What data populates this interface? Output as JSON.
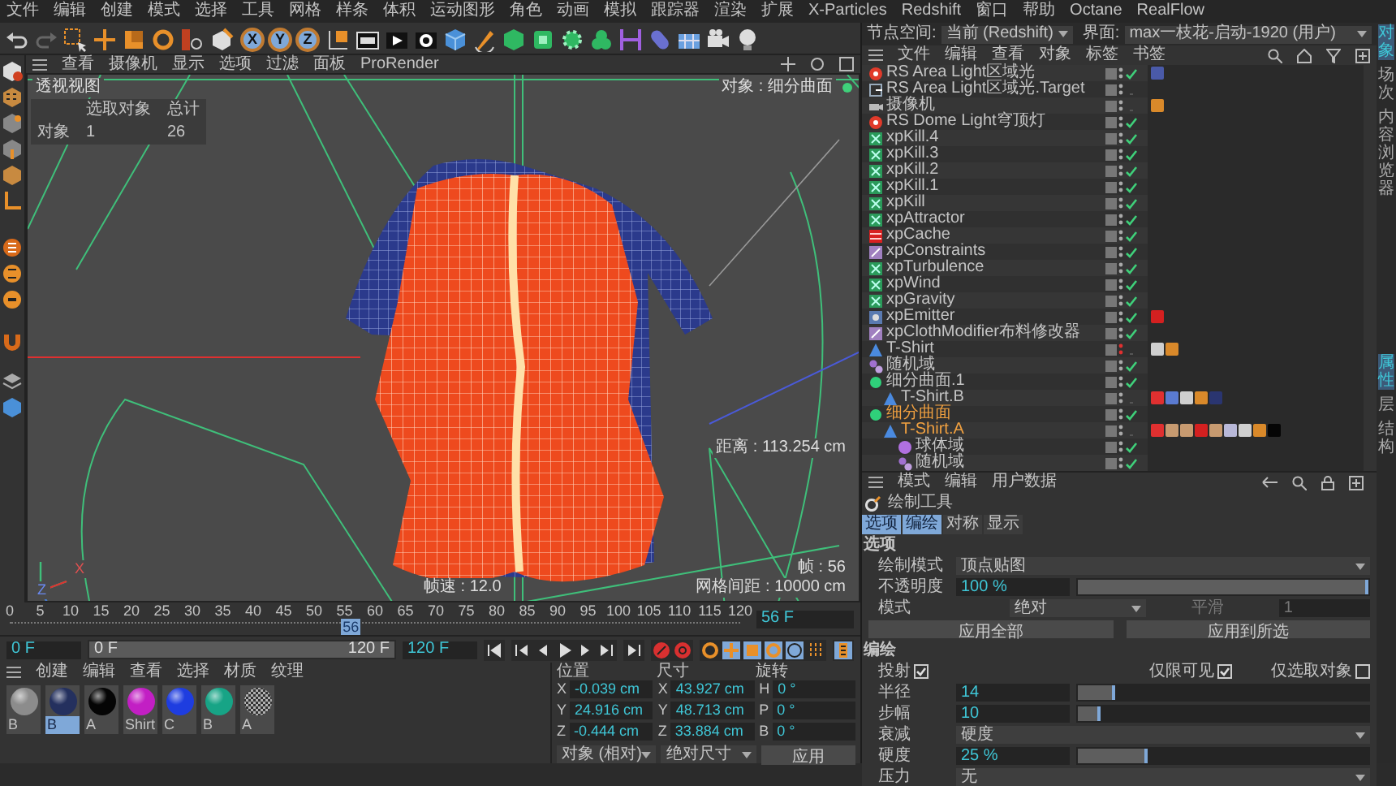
{
  "menu_bar": [
    "文件",
    "编辑",
    "创建",
    "模式",
    "选择",
    "工具",
    "网格",
    "样条",
    "体积",
    "运动图形",
    "角色",
    "动画",
    "模拟",
    "跟踪器",
    "渲染",
    "扩展",
    "X-Particles",
    "Redshift",
    "窗口",
    "帮助",
    "Octane",
    "RealFlow"
  ],
  "toolbar": {
    "axis_buttons": [
      {
        "label": "X",
        "on": true
      },
      {
        "label": "Y",
        "on": true
      },
      {
        "label": "Z",
        "on": true
      }
    ]
  },
  "viewport": {
    "menu": [
      "查看",
      "摄像机",
      "显示",
      "选项",
      "过滤",
      "面板",
      "ProRender"
    ],
    "view_name": "透视视图",
    "stats": {
      "header_1": "选取对象",
      "header_2": "总计",
      "row_label": "对象",
      "selected": "1",
      "total": "26"
    },
    "active_object": "对象 : 细分曲面",
    "distance": "距离 : 113.254 cm",
    "fps": "帧速 : 12.0",
    "frame": "帧 : 56",
    "grid_spacing": "网格间距 : 10000 cm",
    "axes": [
      "X",
      "Z"
    ]
  },
  "timeline": {
    "ticks": [
      "0",
      "5",
      "10",
      "15",
      "20",
      "25",
      "30",
      "35",
      "40",
      "45",
      "50",
      "55",
      "60",
      "65",
      "70",
      "75",
      "80",
      "85",
      "90",
      "95",
      "100",
      "105",
      "110",
      "115",
      "120"
    ],
    "current": "56",
    "level": 0.467,
    "current_field": "56 F",
    "start_field": "0 F",
    "range": {
      "start": "0 F",
      "end": "120 F",
      "level": 1
    },
    "end_field": "120 F"
  },
  "materials": {
    "menu": [
      "创建",
      "编辑",
      "查看",
      "选择",
      "材质",
      "纹理"
    ],
    "items": [
      {
        "name": "B",
        "kind": "sphere",
        "color": "#8c8c8c",
        "selected": false
      },
      {
        "name": "B",
        "kind": "sphere",
        "color": "#24305e",
        "selected": true
      },
      {
        "name": "A",
        "kind": "sphere",
        "color": "#050505",
        "selected": false
      },
      {
        "name": "Shirt",
        "kind": "sphere",
        "color": "#c21fc4",
        "selected": false
      },
      {
        "name": "C",
        "kind": "sphere",
        "color": "#1e3de0",
        "selected": false
      },
      {
        "name": "B",
        "kind": "sphere",
        "color": "#17a486",
        "selected": false
      },
      {
        "name": "A",
        "kind": "checker",
        "color": "#b0b0b0",
        "selected": false
      }
    ]
  },
  "coordinates": {
    "headers": [
      "位置",
      "尺寸",
      "旋转"
    ],
    "columns": [
      [
        {
          "axis": "X",
          "value": "-0.039 cm"
        },
        {
          "axis": "Y",
          "value": "24.916 cm"
        },
        {
          "axis": "Z",
          "value": "-0.444 cm"
        }
      ],
      [
        {
          "axis": "X",
          "value": "43.927 cm"
        },
        {
          "axis": "Y",
          "value": "48.713 cm"
        },
        {
          "axis": "Z",
          "value": "33.884 cm"
        }
      ],
      [
        {
          "axis": "H",
          "value": "0 °"
        },
        {
          "axis": "P",
          "value": "0 °"
        },
        {
          "axis": "B",
          "value": "0 °"
        }
      ]
    ],
    "mode": "对象 (相对)",
    "size_mode": "绝对尺寸",
    "apply": "应用"
  },
  "header": {
    "node_space_label": "节点空间:",
    "node_space": "当前 (Redshift)",
    "layout_label": "界面:",
    "layout": "max一枝花-启动-1920 (用户)"
  },
  "objects": {
    "menu": [
      "文件",
      "编辑",
      "查看",
      "对象",
      "标签",
      "书签"
    ],
    "rows": [
      {
        "name": "RS Area Light区域光",
        "kind": "light",
        "enabled": true,
        "hidden": false,
        "selected": false,
        "tags": [
          {
            "color": "#4a5aa8"
          }
        ]
      },
      {
        "name": "RS Area Light区域光.Target",
        "kind": "target",
        "enabled": false,
        "hidden": false,
        "selected": false
      },
      {
        "name": "摄像机",
        "kind": "camera",
        "enabled": false,
        "hidden": false,
        "selected": false,
        "tags": [
          {
            "color": "#d9892a"
          }
        ]
      },
      {
        "name": "RS Dome Light穹顶灯",
        "kind": "light",
        "enabled": true,
        "hidden": false,
        "selected": false
      },
      {
        "name": "xpKill.4",
        "kind": "xp",
        "enabled": true,
        "hidden": false,
        "selected": false
      },
      {
        "name": "xpKill.3",
        "kind": "xp",
        "enabled": true,
        "hidden": false,
        "selected": false
      },
      {
        "name": "xpKill.2",
        "kind": "xp",
        "enabled": true,
        "hidden": false,
        "selected": false
      },
      {
        "name": "xpKill.1",
        "kind": "xp",
        "enabled": true,
        "hidden": false,
        "selected": false
      },
      {
        "name": "xpKill",
        "kind": "xp",
        "enabled": true,
        "hidden": false,
        "selected": false
      },
      {
        "name": "xpAttractor",
        "kind": "xp",
        "enabled": true,
        "hidden": false,
        "selected": false
      },
      {
        "name": "xpCache",
        "kind": "cache",
        "enabled": true,
        "hidden": false,
        "selected": false
      },
      {
        "name": "xpConstraints",
        "kind": "constraint",
        "enabled": true,
        "hidden": false,
        "selected": false
      },
      {
        "name": "xpTurbulence",
        "kind": "xp",
        "enabled": true,
        "hidden": false,
        "selected": false
      },
      {
        "name": "xpWind",
        "kind": "xp",
        "enabled": true,
        "hidden": false,
        "selected": false
      },
      {
        "name": "xpGravity",
        "kind": "xp",
        "enabled": true,
        "hidden": false,
        "selected": false
      },
      {
        "name": "xpEmitter",
        "kind": "emitter",
        "enabled": true,
        "hidden": false,
        "selected": false,
        "tags": [
          {
            "color": "#d42020"
          }
        ]
      },
      {
        "name": "xpClothModifier布料修改器",
        "kind": "constraint",
        "enabled": true,
        "hidden": false,
        "selected": false
      },
      {
        "name": "T-Shirt",
        "kind": "mesh",
        "enabled": false,
        "hidden": true,
        "selected": false,
        "tags": [
          {
            "color": "#cfcfcf"
          },
          {
            "color": "#d9892a"
          }
        ]
      },
      {
        "name": "随机域",
        "kind": "field",
        "enabled": true,
        "hidden": false,
        "selected": false
      },
      {
        "name": "细分曲面.1",
        "kind": "subdivision",
        "enabled": true,
        "hidden": false,
        "selected": false,
        "children": [
          {
            "name": "T-Shirt.B",
            "kind": "mesh",
            "enabled": false,
            "hidden": false,
            "selected": false,
            "tags": [
              {
                "color": "#e03030"
              },
              {
                "color": "#5a7ad0"
              },
              {
                "color": "#cfcfcf"
              },
              {
                "color": "#d9892a"
              },
              {
                "color": "#2a3570"
              }
            ]
          }
        ]
      },
      {
        "name": "细分曲面",
        "kind": "subdivision",
        "enabled": true,
        "hidden": false,
        "selected": true,
        "children": [
          {
            "name": "T-Shirt.A",
            "kind": "mesh",
            "enabled": false,
            "hidden": false,
            "selected": true,
            "tags": [
              {
                "color": "#e03030"
              },
              {
                "color": "#c79a70"
              },
              {
                "color": "#c79a70"
              },
              {
                "color": "#d42020"
              },
              {
                "color": "#c79a70"
              },
              {
                "color": "#b8b8d8"
              },
              {
                "color": "#cfcfcf"
              },
              {
                "color": "#d9892a"
              },
              {
                "color": "#050505"
              }
            ],
            "children": [
              {
                "name": "球体域",
                "kind": "sphere-field",
                "enabled": true,
                "hidden": false,
                "selected": false
              },
              {
                "name": "随机域",
                "kind": "field",
                "enabled": true,
                "hidden": false,
                "selected": false
              }
            ]
          }
        ]
      }
    ]
  },
  "attributes": {
    "menu": [
      "模式",
      "编辑",
      "用户数据"
    ],
    "tool": "绘制工具",
    "tabs": [
      {
        "label": "选项",
        "selected": true
      },
      {
        "label": "编绘",
        "selected": true
      },
      {
        "label": "对称",
        "selected": false
      },
      {
        "label": "显示",
        "selected": false
      }
    ],
    "sections": [
      {
        "title": "选项",
        "rows": [
          {
            "kind": "dropdown",
            "label": "绘制模式",
            "value": "顶点贴图"
          },
          {
            "kind": "slider",
            "label": "不透明度",
            "value": "100 %",
            "level": 1
          },
          {
            "kind": "split",
            "label": "模式",
            "value": "绝对",
            "label_2": "平滑",
            "value_2": "1",
            "disabled_2": true
          },
          {
            "kind": "buttons",
            "buttons": [
              "应用全部",
              "应用到所选"
            ]
          }
        ]
      },
      {
        "title": "编绘",
        "rows": [
          {
            "kind": "checks",
            "checks": [
              {
                "label": "投射",
                "checked": true
              },
              {
                "label": "仅限可见",
                "checked": true
              },
              {
                "label": "仅选取对象",
                "checked": false
              }
            ]
          },
          {
            "kind": "slider",
            "label": "半径",
            "value": "14",
            "level": 0.14
          },
          {
            "kind": "slider",
            "label": "步幅",
            "value": "10",
            "level": 0.09
          },
          {
            "kind": "dropdown",
            "label": "衰减",
            "value": "硬度"
          },
          {
            "kind": "slider",
            "label": "硬度",
            "value": "25 %",
            "level": 0.25
          },
          {
            "kind": "dropdown",
            "label": "压力",
            "value": "无"
          }
        ]
      }
    ]
  },
  "side_tabs": {
    "top": [
      {
        "label": "对象",
        "selected": true
      },
      {
        "label": "场次",
        "selected": false
      },
      {
        "label": "内容浏览器",
        "selected": false
      }
    ],
    "bottom": [
      {
        "label": "属性",
        "selected": true
      },
      {
        "label": "层",
        "selected": false
      },
      {
        "label": "结构",
        "selected": false
      }
    ]
  }
}
